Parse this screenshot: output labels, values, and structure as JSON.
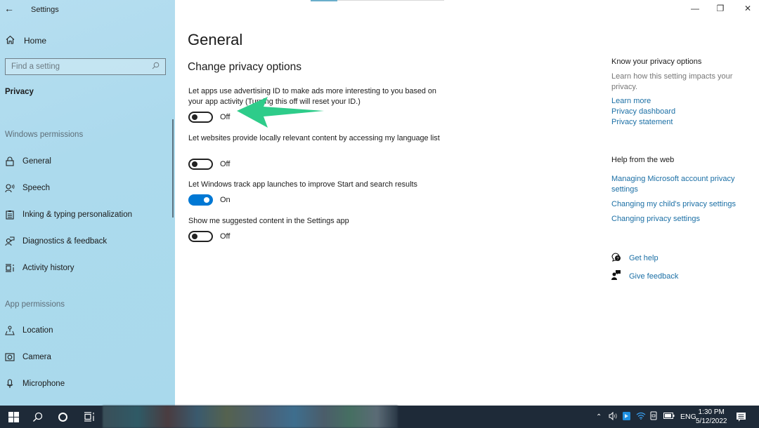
{
  "window": {
    "title": "Settings",
    "controls": {
      "minimize": "—",
      "maximize": "❐",
      "close": "✕"
    }
  },
  "sidebar": {
    "home_label": "Home",
    "search_placeholder": "Find a setting",
    "current_section": "Privacy",
    "windows_permissions_header": "Windows permissions",
    "windows_permissions": [
      {
        "label": "General",
        "icon": "lock-icon"
      },
      {
        "label": "Speech",
        "icon": "speech-icon"
      },
      {
        "label": "Inking & typing personalization",
        "icon": "clipboard-icon"
      },
      {
        "label": "Diagnostics & feedback",
        "icon": "diagnostics-icon"
      },
      {
        "label": "Activity history",
        "icon": "activity-history-icon"
      }
    ],
    "app_permissions_header": "App permissions",
    "app_permissions": [
      {
        "label": "Location",
        "icon": "location-icon"
      },
      {
        "label": "Camera",
        "icon": "camera-icon"
      },
      {
        "label": "Microphone",
        "icon": "microphone-icon"
      }
    ]
  },
  "main": {
    "title": "General",
    "subtitle": "Change privacy options",
    "options": [
      {
        "label": "Let apps use advertising ID to make ads more interesting to you based on your app activity (Turning this off will reset your ID.)",
        "state": "Off",
        "on": false
      },
      {
        "label": "Let websites provide locally relevant content by accessing my language list",
        "state": "Off",
        "on": false
      },
      {
        "label": "Let Windows track app launches to improve Start and search results",
        "state": "On",
        "on": true
      },
      {
        "label": "Show me suggested content in the Settings app",
        "state": "Off",
        "on": false
      }
    ],
    "annotation_arrow_color": "#2ecc8a",
    "toggle_on_color": "#0078d4"
  },
  "right": {
    "know_header": "Know your privacy options",
    "know_text": "Learn how this setting impacts your privacy.",
    "know_links": [
      "Learn more",
      "Privacy dashboard",
      "Privacy statement"
    ],
    "help_header": "Help from the web",
    "help_links": [
      "Managing Microsoft account privacy settings",
      "Changing my child's privacy settings",
      "Changing privacy settings"
    ],
    "get_help": "Get help",
    "give_feedback": "Give feedback",
    "link_color": "#1b6fa5"
  },
  "taskbar": {
    "language": "ENG",
    "time": "1:30 PM",
    "date": "5/12/2022"
  }
}
